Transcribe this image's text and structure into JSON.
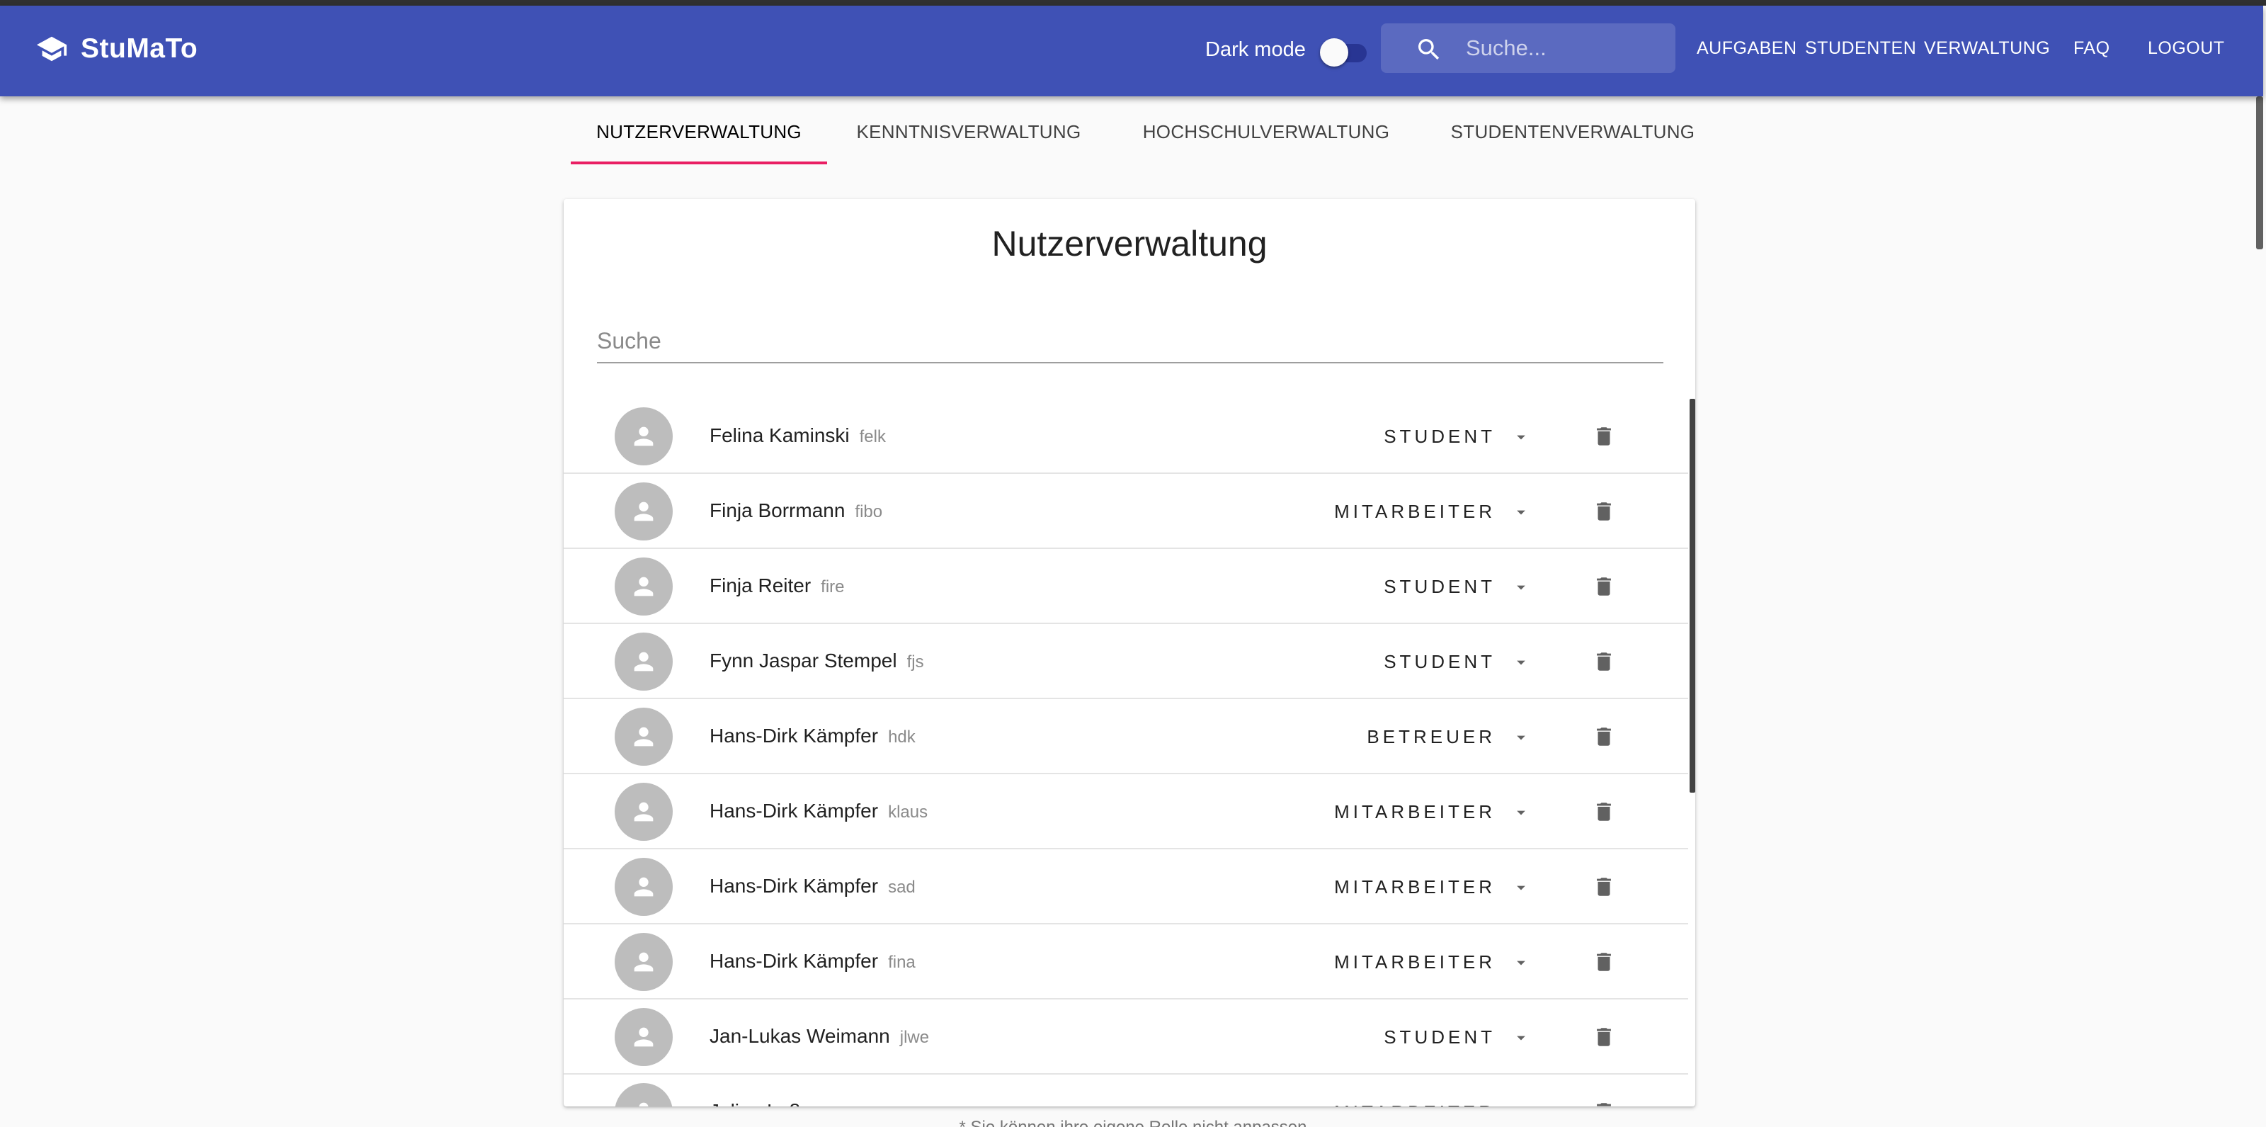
{
  "app": {
    "title": "StuMaTo",
    "logo_icon": "graduation-cap-icon"
  },
  "header": {
    "dark_mode_label": "Dark mode",
    "dark_mode_enabled": false,
    "search_placeholder": "Suche...",
    "nav": [
      "AUFGABEN",
      "STUDENTEN",
      "VERWALTUNG",
      "FAQ",
      "LOGOUT"
    ]
  },
  "tabs": {
    "active": "NUTZERVERWALTUNG",
    "items": [
      "NUTZERVERWALTUNG",
      "KENNTNISVERWALTUNG",
      "HOCHSCHULVERWALTUNG",
      "STUDENTENVERWALTUNG"
    ]
  },
  "panel": {
    "title": "Nutzerverwaltung",
    "search_placeholder": "Suche"
  },
  "users": [
    {
      "name": "Felina Kaminski",
      "login": "felk",
      "role": "STUDENT"
    },
    {
      "name": "Finja Borrmann",
      "login": "fibo",
      "role": "MITARBEITER"
    },
    {
      "name": "Finja Reiter",
      "login": "fire",
      "role": "STUDENT"
    },
    {
      "name": "Fynn Jaspar Stempel",
      "login": "fjs",
      "role": "STUDENT"
    },
    {
      "name": "Hans-Dirk Kämpfer",
      "login": "hdk",
      "role": "BETREUER"
    },
    {
      "name": "Hans-Dirk Kämpfer",
      "login": "klaus",
      "role": "MITARBEITER"
    },
    {
      "name": "Hans-Dirk Kämpfer",
      "login": "sad",
      "role": "MITARBEITER"
    },
    {
      "name": "Hans-Dirk Kämpfer",
      "login": "fina",
      "role": "MITARBEITER"
    },
    {
      "name": "Jan-Lukas Weimann",
      "login": "jlwe",
      "role": "STUDENT"
    },
    {
      "name": "Julian Laß",
      "login": "",
      "role": "MITARBEITER"
    }
  ],
  "footnote": "* Sie können ihre eigene Rolle nicht anpassen",
  "colors": {
    "primary": "#3f51b5",
    "accent": "#e91e63"
  }
}
